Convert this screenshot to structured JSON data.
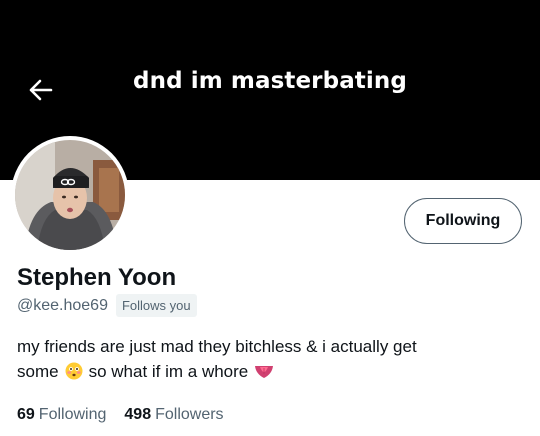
{
  "header": {
    "title": "dnd im masterbating",
    "back_icon": "arrow-left-icon"
  },
  "profile": {
    "display_name": "Stephen Yoon",
    "handle": "@kee.hoe69",
    "follows_you_label": "Follows you",
    "follow_button_label": "Following",
    "bio": {
      "line1": "my friends are just mad they bitchless & i actually get",
      "line2_part1": "some",
      "emoji1": "flushed-face-emoji",
      "line2_part2": "so what if im a whore",
      "emoji2": "tongue-emoji"
    }
  },
  "stats": {
    "following_count": "69",
    "following_label": "Following",
    "followers_count": "498",
    "followers_label": "Followers"
  },
  "colors": {
    "banner": "#000000",
    "text_primary": "#0f1419",
    "text_secondary": "#536471",
    "badge_bg": "#eff3f4"
  }
}
